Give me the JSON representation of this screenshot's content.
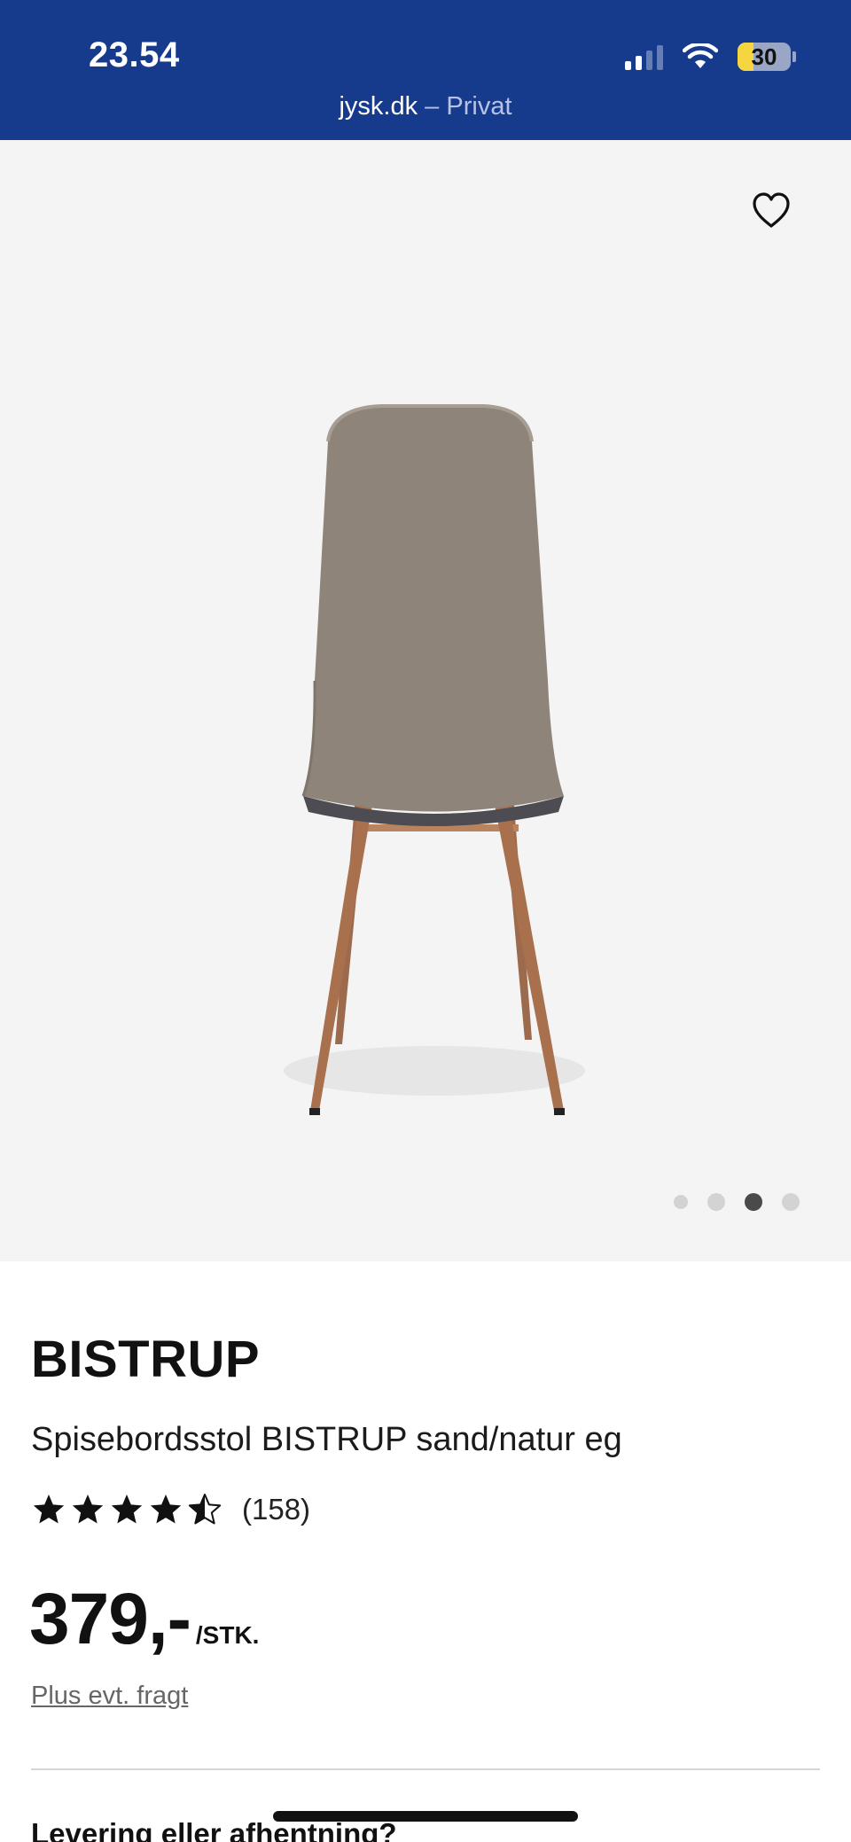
{
  "status_bar": {
    "time": "23.54",
    "battery_level": "30",
    "url": "jysk.dk",
    "separator": "–",
    "browsing_mode": "Privat",
    "colors": {
      "background": "#163a8c",
      "battery_low": "#f6d640"
    }
  },
  "gallery": {
    "favorite_icon": "heart-outline-icon",
    "image": "chair-back-view",
    "dots_count": 4,
    "active_dot": 3
  },
  "product": {
    "brand": "BISTRUP",
    "name": "Spisebordsstol BISTRUP sand/natur eg",
    "rating_stars": 4.5,
    "rating_count": "(158)",
    "price": "379,-",
    "price_unit": "/STK.",
    "shipping_link": "Plus evt. fragt",
    "delivery_heading": "Levering eller afhentning?"
  }
}
